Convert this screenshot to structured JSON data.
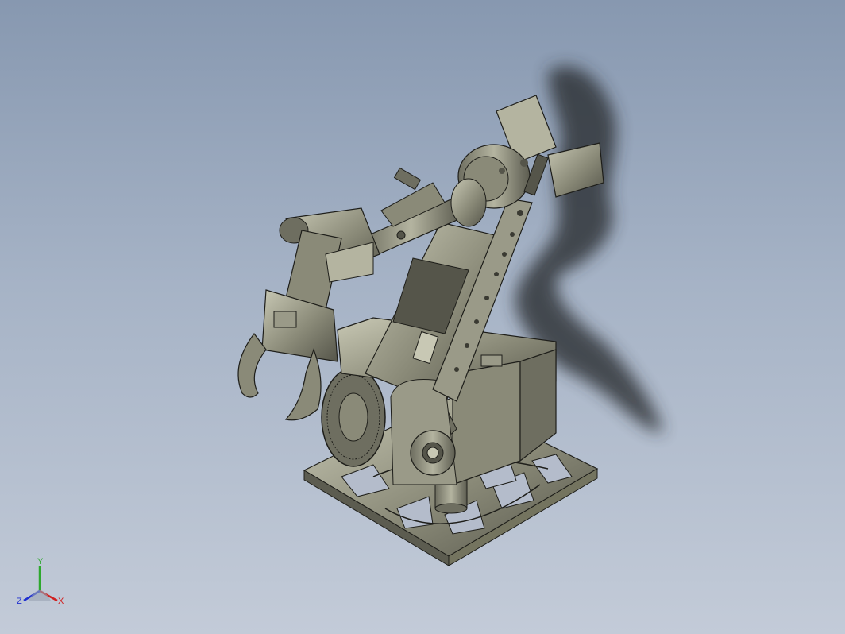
{
  "viewport": {
    "background_top": "#8798b0",
    "background_bottom": "#c3cbd8"
  },
  "model": {
    "part_color": "#8a8a78",
    "part_highlight": "#c8c8b4",
    "part_shadow": "#55554a",
    "edge_color": "#1e1e1a",
    "shadow_color": "#2a2d33",
    "icon": "robot-arm-model"
  },
  "triad": {
    "y_label": "Y",
    "x_label": "X",
    "z_label": "Z",
    "y_color": "#2ea82e",
    "x_color": "#d02020",
    "z_color": "#2030d0"
  }
}
